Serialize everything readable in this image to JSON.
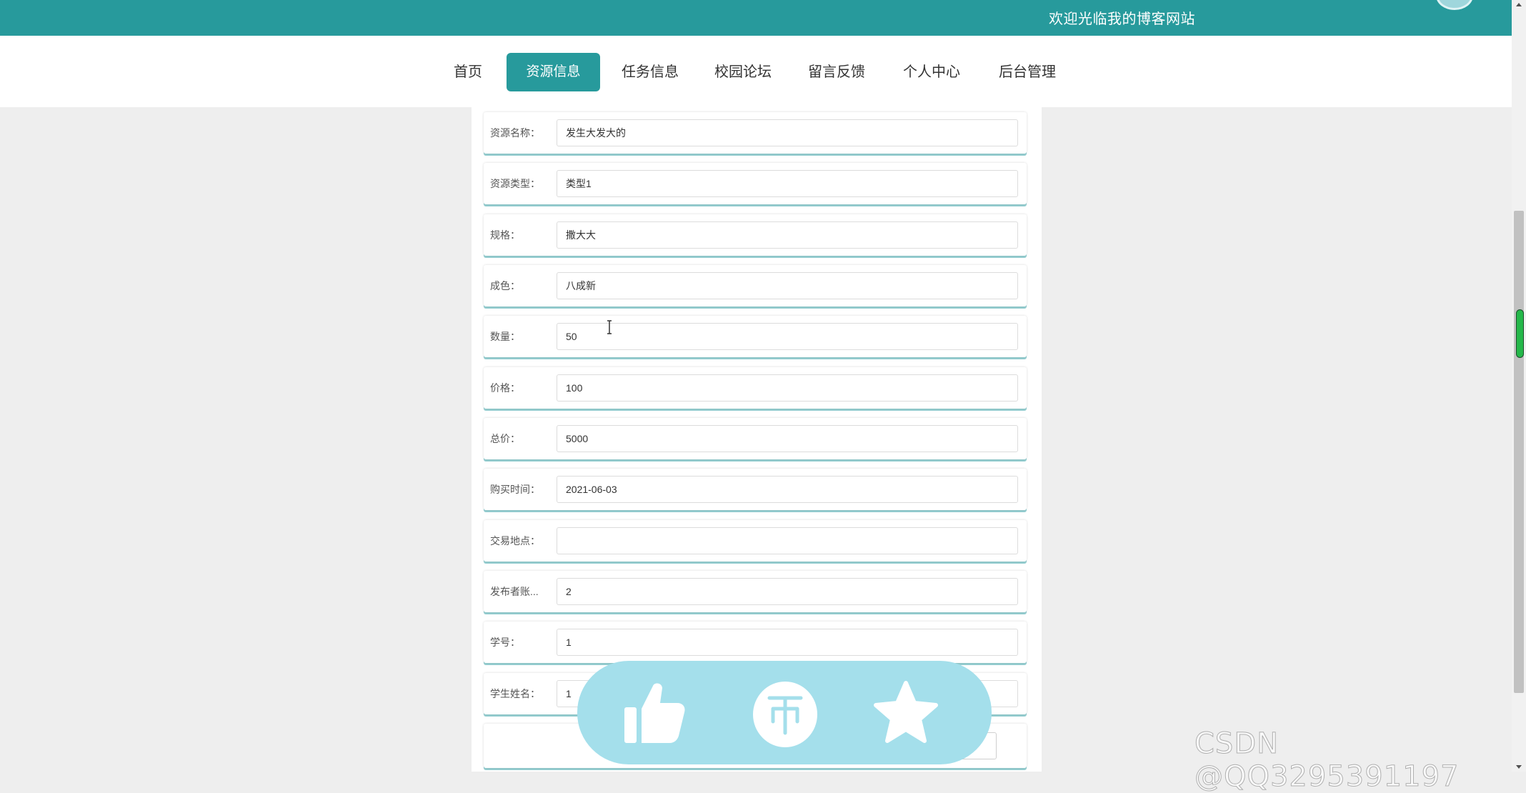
{
  "header": {
    "welcome_text": "欢迎光临我的博客网站"
  },
  "nav": {
    "items": [
      {
        "label": "首页"
      },
      {
        "label": "资源信息"
      },
      {
        "label": "任务信息"
      },
      {
        "label": "校园论坛"
      },
      {
        "label": "留言反馈"
      },
      {
        "label": "个人中心"
      },
      {
        "label": "后台管理"
      }
    ],
    "active": "资源信息"
  },
  "form": {
    "rows": [
      {
        "label": "资源名称：",
        "value": "发生大发大的"
      },
      {
        "label": "资源类型：",
        "value": "类型1"
      },
      {
        "label": "规格：",
        "value": "撒大大"
      },
      {
        "label": "成色：",
        "value": "八成新"
      },
      {
        "label": "数量：",
        "value": "50"
      },
      {
        "label": "价格：",
        "value": "100"
      },
      {
        "label": "总价：",
        "value": "5000"
      },
      {
        "label": "购买时间：",
        "value": "2021-06-03"
      },
      {
        "label": "交易地点：",
        "value": ""
      },
      {
        "label": "发布者账...",
        "value": "2"
      },
      {
        "label": "学号：",
        "value": "1"
      },
      {
        "label": "学生姓名：",
        "value": "1"
      }
    ]
  },
  "overlay": {
    "icons": [
      "thumbs-up-icon",
      "coin-icon",
      "star-icon"
    ],
    "color": "#a4dfeb"
  },
  "colors": {
    "brand": "#279a9c",
    "background": "#eeeeee"
  },
  "watermark": "CSDN @QQ3295391197"
}
